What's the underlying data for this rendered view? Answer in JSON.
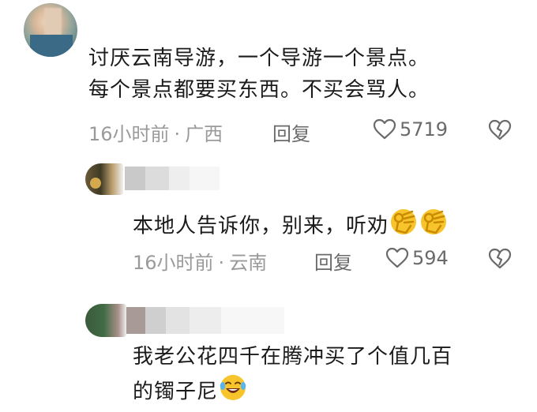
{
  "comments": [
    {
      "text_line1": "讨厌云南导游，一个导游一个景点。",
      "text_line2": "每个景点都要买东西。不买会骂人。",
      "time": "16小时前",
      "location": "广西",
      "reply_label": "回复",
      "likes": "5719"
    }
  ],
  "replies": [
    {
      "text": "本地人告诉你，别来，听劝",
      "emojis": [
        "ok-hand-emoji",
        "ok-hand-emoji"
      ],
      "time": "16小时前",
      "location": "云南",
      "reply_label": "回复",
      "likes": "594"
    },
    {
      "text_line1": "我老公花四千在腾冲买了个值几百",
      "text_line2": "的镯子尼",
      "emojis": [
        "laughing-tears-emoji"
      ]
    }
  ],
  "meta_separator": "·",
  "colors": {
    "text": "#1b1b1b",
    "meta": "#9a9a9a",
    "action": "#6a6a6a",
    "emoji_yellow": "#f7c52b"
  }
}
